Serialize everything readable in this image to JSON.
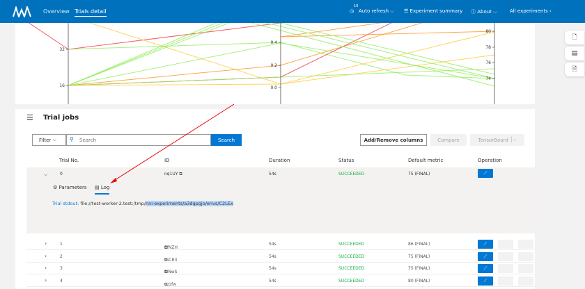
{
  "nav": {
    "overview": "Overview",
    "trials_detail": "Trials detail",
    "refresh_count": "10",
    "auto_refresh": "Auto refresh",
    "experiment_summary": "Experiment summary",
    "about": "About",
    "all_experiments": "All experiments"
  },
  "chart": {
    "axis1_ticks": [
      "32",
      "16"
    ],
    "axis2_ticks": [
      "0.4",
      "0.2",
      "0.0"
    ],
    "axis3_ticks": [
      "80",
      "78",
      "76",
      "74"
    ]
  },
  "trial_jobs": {
    "title": "Trial jobs",
    "filter": "Filter",
    "search_placeholder": "Search",
    "search_button": "Search",
    "add_remove": "Add/Remove columns",
    "compare": "Compare",
    "tensorboard": "TensorBoard",
    "columns": [
      "Trial No.",
      "ID",
      "Duration",
      "Status",
      "Default metric",
      "Operation"
    ],
    "expanded": {
      "tab_parameters": "Parameters",
      "tab_log": "Log",
      "stdout_label": "Trial stdout:",
      "stdout_path_plain": "file://test-worker-2.test:/tmp/",
      "stdout_path_selected": "nni-experiments/a3dqpgjo/envs/C2LEx"
    },
    "rows": [
      {
        "no": "0",
        "id": "nq1UY",
        "duration": "54s",
        "status": "SUCCEEDED",
        "metric": "75 (FINAL)"
      },
      {
        "no": "1",
        "id": "EfNZH",
        "duration": "54s",
        "status": "SUCCEEDED",
        "metric": "86 (FINAL)"
      },
      {
        "no": "2",
        "id": "tSCR3",
        "duration": "54s",
        "status": "SUCCEEDED",
        "metric": "75 (FINAL)"
      },
      {
        "no": "3",
        "id": "FINwS",
        "duration": "54s",
        "status": "SUCCEEDED",
        "metric": "75 (FINAL)"
      },
      {
        "no": "4",
        "id": "uzzfw",
        "duration": "54s",
        "status": "SUCCEEDED",
        "metric": "80 (FINAL)"
      }
    ]
  }
}
